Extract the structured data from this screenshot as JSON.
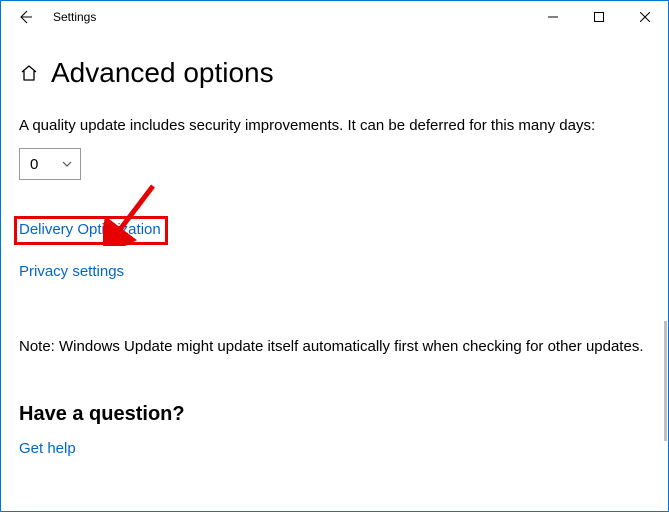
{
  "window": {
    "title": "Settings"
  },
  "page": {
    "title": "Advanced options",
    "defer_text": "A quality update includes security improvements. It can be deferred for this many days:",
    "defer_value": "0",
    "link_delivery": "Delivery Optimization",
    "link_privacy": "Privacy settings",
    "note": "Note: Windows Update might update itself automatically first when checking for other updates.",
    "question_heading": "Have a question?",
    "get_help": "Get help"
  },
  "icons": {
    "back": "back-arrow-icon",
    "home": "home-icon",
    "minimize": "minimize-icon",
    "maximize": "maximize-icon",
    "close": "close-icon",
    "chevron": "chevron-down-icon"
  },
  "annotation": {
    "arrow_color": "#e60000"
  }
}
